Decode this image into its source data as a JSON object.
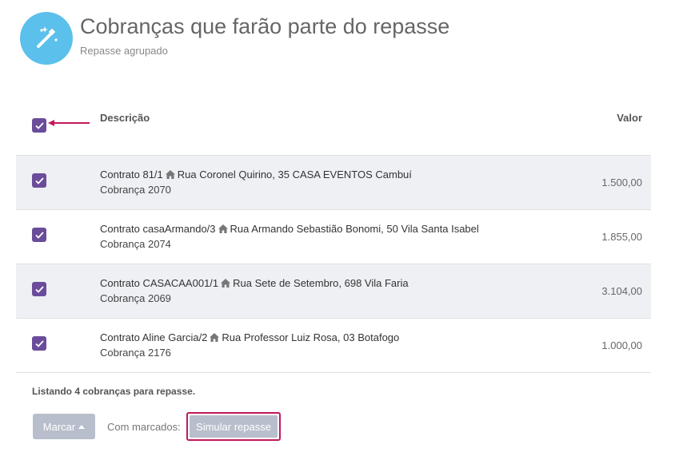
{
  "header": {
    "icon": "magic-wand-icon",
    "title": "Cobranças que farão parte do repasse",
    "subtitle": "Repasse agrupado"
  },
  "table": {
    "columns": {
      "description": "Descrição",
      "value": "Valor"
    },
    "select_all_checked": true,
    "rows": [
      {
        "contract": "Contrato 81/1",
        "address": "Rua Coronel Quirino, 35 CASA EVENTOS Cambuí",
        "charge": "Cobrança 2070",
        "value": "1.500,00",
        "checked": true
      },
      {
        "contract": "Contrato casaArmando/3",
        "address": "Rua Armando Sebastião Bonomi, 50 Vila Santa Isabel",
        "charge": "Cobrança 2074",
        "value": "1.855,00",
        "checked": true
      },
      {
        "contract": "Contrato CASACAA001/1",
        "address": "Rua Sete de Setembro, 698 Vila Faria",
        "charge": "Cobrança 2069",
        "value": "3.104,00",
        "checked": true
      },
      {
        "contract": "Contrato Aline Garcia/2",
        "address": "Rua Professor Luiz Rosa, 03 Botafogo",
        "charge": "Cobrança 2176",
        "value": "1.000,00",
        "checked": true
      }
    ]
  },
  "footer": {
    "listing": "Listando 4 cobranças para repasse.",
    "marcar_label": "Marcar",
    "com_marcados_label": "Com marcados:",
    "simular_label": "Simular repasse"
  },
  "colors": {
    "checkbox": "#6b4c9a",
    "header_icon_bg": "#5bc0eb",
    "highlight": "#c2185b",
    "button_bg": "#b8becc"
  }
}
